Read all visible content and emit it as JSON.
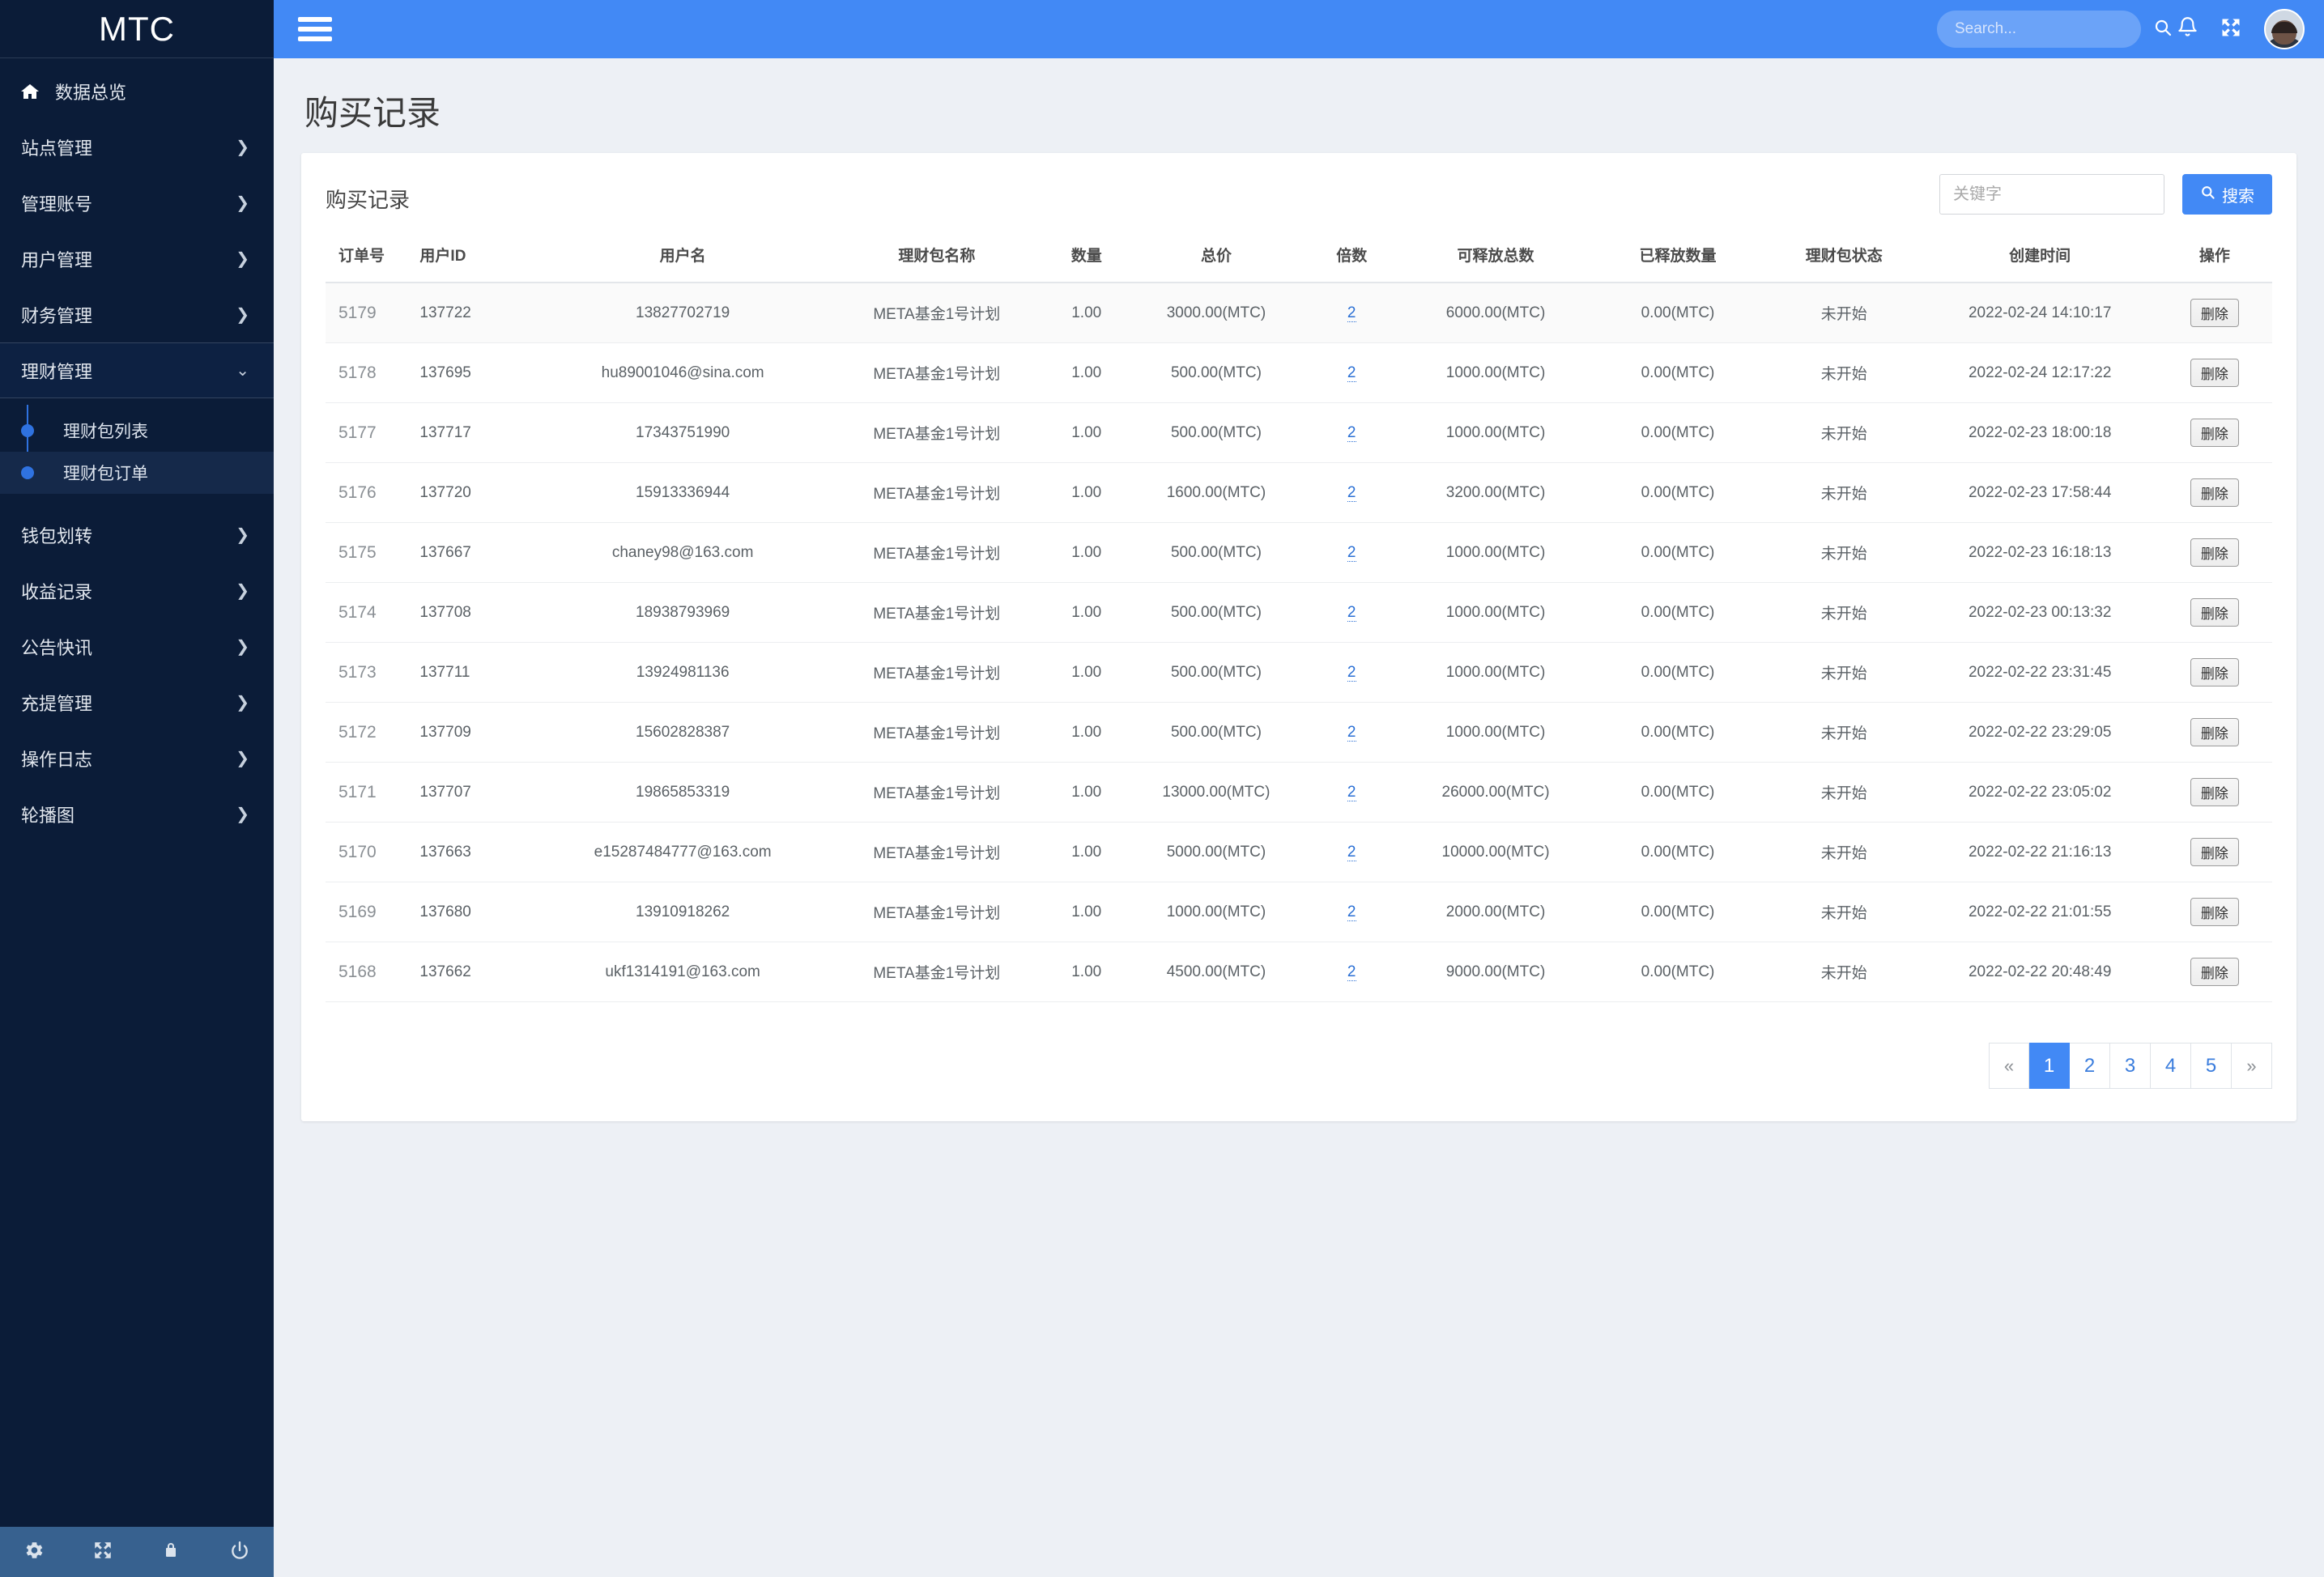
{
  "brand": {
    "title": "MTC"
  },
  "sidebar": {
    "dashboard": {
      "label": "数据总览",
      "icon": "home-icon"
    },
    "items": [
      {
        "label": "站点管理",
        "icon": "chevron-right-icon"
      },
      {
        "label": "管理账号",
        "icon": "chevron-right-icon"
      },
      {
        "label": "用户管理",
        "icon": "chevron-right-icon"
      },
      {
        "label": "财务管理",
        "icon": "chevron-right-icon"
      },
      {
        "label": "理财管理",
        "icon": "chevron-down-icon",
        "expanded": true
      },
      {
        "label": "钱包划转",
        "icon": "chevron-right-icon"
      },
      {
        "label": "收益记录",
        "icon": "chevron-right-icon"
      },
      {
        "label": "公告快讯",
        "icon": "chevron-right-icon"
      },
      {
        "label": "充提管理",
        "icon": "chevron-right-icon"
      },
      {
        "label": "操作日志",
        "icon": "chevron-right-icon"
      },
      {
        "label": "轮播图",
        "icon": "chevron-right-icon"
      }
    ],
    "submenu": [
      {
        "label": "理财包列表",
        "active": false
      },
      {
        "label": "理财包订单",
        "active": true
      }
    ],
    "footer_icons": [
      "gear-icon",
      "expand-icon",
      "lock-icon",
      "power-icon"
    ]
  },
  "topbar": {
    "menu_icon": "hamburger-icon",
    "search": {
      "placeholder": "Search...",
      "value": "",
      "icon": "search-icon"
    },
    "notification_icon": "bell-icon",
    "fullscreen_icon": "expand-icon",
    "avatar": "user-avatar"
  },
  "page": {
    "title": "购买记录"
  },
  "card": {
    "title": "购买记录",
    "filter": {
      "placeholder": "关键字",
      "value": ""
    },
    "search_button": {
      "label": "搜索",
      "icon": "search-icon"
    }
  },
  "table": {
    "columns": [
      "订单号",
      "用户ID",
      "用户名",
      "理财包名称",
      "数量",
      "总价",
      "倍数",
      "可释放总数",
      "已释放数量",
      "理财包状态",
      "创建时间",
      "操作"
    ],
    "action_label": "删除",
    "rows": [
      {
        "order": "5179",
        "uid": "137722",
        "uname": "13827702719",
        "pkg": "META基金1号计划",
        "qty": "1.00",
        "price": "3000.00(MTC)",
        "mult": "2",
        "releasable": "6000.00(MTC)",
        "released": "0.00(MTC)",
        "state": "未开始",
        "created": "2022-02-24 14:10:17"
      },
      {
        "order": "5178",
        "uid": "137695",
        "uname": "hu89001046@sina.com",
        "pkg": "META基金1号计划",
        "qty": "1.00",
        "price": "500.00(MTC)",
        "mult": "2",
        "releasable": "1000.00(MTC)",
        "released": "0.00(MTC)",
        "state": "未开始",
        "created": "2022-02-24 12:17:22"
      },
      {
        "order": "5177",
        "uid": "137717",
        "uname": "17343751990",
        "pkg": "META基金1号计划",
        "qty": "1.00",
        "price": "500.00(MTC)",
        "mult": "2",
        "releasable": "1000.00(MTC)",
        "released": "0.00(MTC)",
        "state": "未开始",
        "created": "2022-02-23 18:00:18"
      },
      {
        "order": "5176",
        "uid": "137720",
        "uname": "15913336944",
        "pkg": "META基金1号计划",
        "qty": "1.00",
        "price": "1600.00(MTC)",
        "mult": "2",
        "releasable": "3200.00(MTC)",
        "released": "0.00(MTC)",
        "state": "未开始",
        "created": "2022-02-23 17:58:44"
      },
      {
        "order": "5175",
        "uid": "137667",
        "uname": "chaney98@163.com",
        "pkg": "META基金1号计划",
        "qty": "1.00",
        "price": "500.00(MTC)",
        "mult": "2",
        "releasable": "1000.00(MTC)",
        "released": "0.00(MTC)",
        "state": "未开始",
        "created": "2022-02-23 16:18:13"
      },
      {
        "order": "5174",
        "uid": "137708",
        "uname": "18938793969",
        "pkg": "META基金1号计划",
        "qty": "1.00",
        "price": "500.00(MTC)",
        "mult": "2",
        "releasable": "1000.00(MTC)",
        "released": "0.00(MTC)",
        "state": "未开始",
        "created": "2022-02-23 00:13:32"
      },
      {
        "order": "5173",
        "uid": "137711",
        "uname": "13924981136",
        "pkg": "META基金1号计划",
        "qty": "1.00",
        "price": "500.00(MTC)",
        "mult": "2",
        "releasable": "1000.00(MTC)",
        "released": "0.00(MTC)",
        "state": "未开始",
        "created": "2022-02-22 23:31:45"
      },
      {
        "order": "5172",
        "uid": "137709",
        "uname": "15602828387",
        "pkg": "META基金1号计划",
        "qty": "1.00",
        "price": "500.00(MTC)",
        "mult": "2",
        "releasable": "1000.00(MTC)",
        "released": "0.00(MTC)",
        "state": "未开始",
        "created": "2022-02-22 23:29:05"
      },
      {
        "order": "5171",
        "uid": "137707",
        "uname": "19865853319",
        "pkg": "META基金1号计划",
        "qty": "1.00",
        "price": "13000.00(MTC)",
        "mult": "2",
        "releasable": "26000.00(MTC)",
        "released": "0.00(MTC)",
        "state": "未开始",
        "created": "2022-02-22 23:05:02"
      },
      {
        "order": "5170",
        "uid": "137663",
        "uname": "e15287484777@163.com",
        "pkg": "META基金1号计划",
        "qty": "1.00",
        "price": "5000.00(MTC)",
        "mult": "2",
        "releasable": "10000.00(MTC)",
        "released": "0.00(MTC)",
        "state": "未开始",
        "created": "2022-02-22 21:16:13"
      },
      {
        "order": "5169",
        "uid": "137680",
        "uname": "13910918262",
        "pkg": "META基金1号计划",
        "qty": "1.00",
        "price": "1000.00(MTC)",
        "mult": "2",
        "releasable": "2000.00(MTC)",
        "released": "0.00(MTC)",
        "state": "未开始",
        "created": "2022-02-22 21:01:55"
      },
      {
        "order": "5168",
        "uid": "137662",
        "uname": "ukf1314191@163.com",
        "pkg": "META基金1号计划",
        "qty": "1.00",
        "price": "4500.00(MTC)",
        "mult": "2",
        "releasable": "9000.00(MTC)",
        "released": "0.00(MTC)",
        "state": "未开始",
        "created": "2022-02-22 20:48:49"
      }
    ]
  },
  "pagination": {
    "prev": "«",
    "next": "»",
    "pages": [
      "1",
      "2",
      "3",
      "4",
      "5"
    ],
    "current": "1"
  },
  "colors": {
    "accent": "#4289f5",
    "sidebar": "#0b1c38",
    "page_bg": "#edf0f5"
  }
}
